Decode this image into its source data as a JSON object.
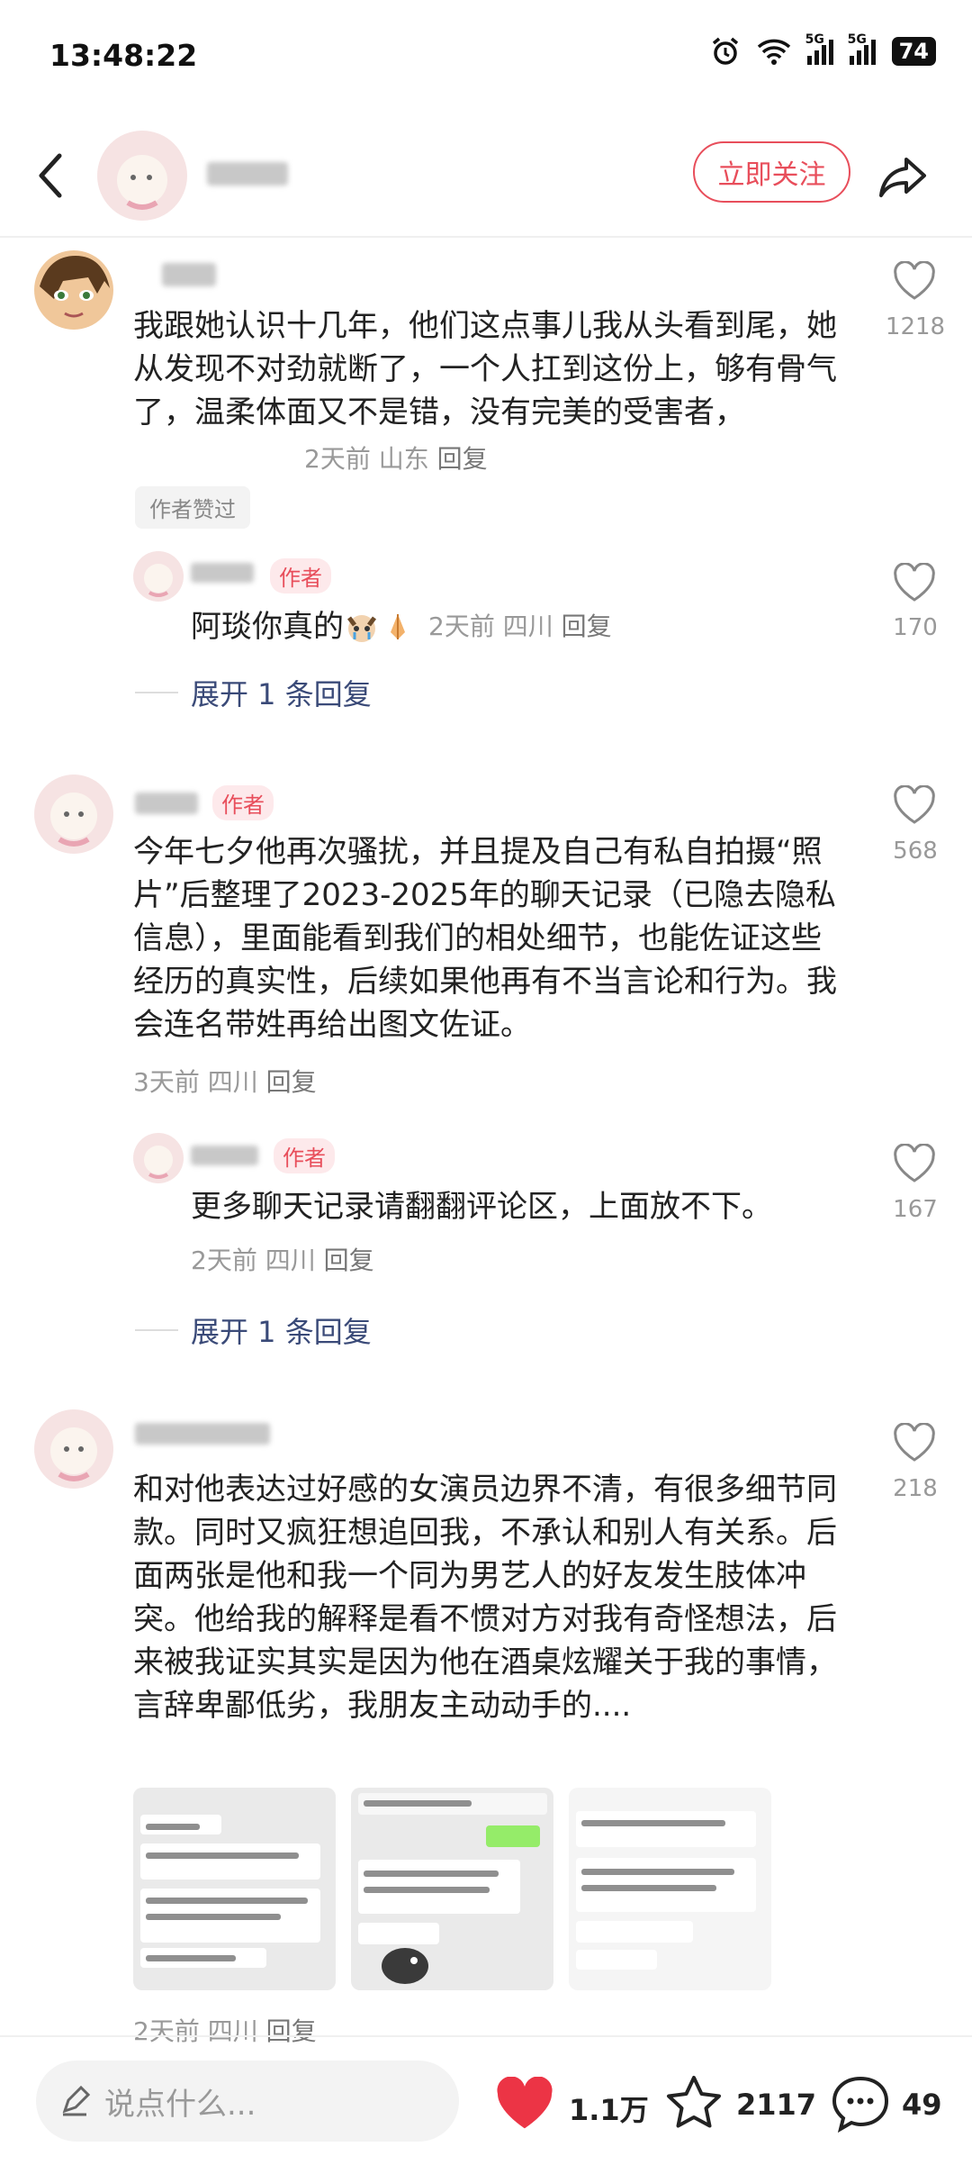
{
  "status": {
    "time": "13:48:22",
    "net1": "5G",
    "net2": "5G",
    "battery": "74"
  },
  "header": {
    "follow_label": "立即关注"
  },
  "comments": [
    {
      "text": "我跟她认识十几年，他们这点事儿我从头看到尾，她从发现不对劲就断了，一个人扛到这份上，够有骨气了，温柔体面又不是错，没有完美的受害者，",
      "time": "2天前",
      "location": "山东",
      "reply_label": "回复",
      "likes": "1218",
      "badge": "作者赞过",
      "sub": {
        "tag": "作者",
        "text": "阿琰你真的",
        "time": "2天前",
        "location": "四川",
        "reply_label": "回复",
        "likes": "170"
      },
      "expand_label": "展开 1 条回复"
    },
    {
      "tag": "作者",
      "text": "今年七夕他再次骚扰，并且提及自己有私自拍摄“照片”后整理了2023-2025年的聊天记录（已隐去隐私信息），里面能看到我们的相处细节，也能佐证这些经历的真实性，后续如果他再有不当言论和行为。我会连名带姓再给出图文佐证。",
      "time": "3天前",
      "location": "四川",
      "reply_label": "回复",
      "likes": "568",
      "sub": {
        "tag": "作者",
        "text": "更多聊天记录请翻翻评论区，上面放不下。",
        "time": "2天前",
        "location": "四川",
        "reply_label": "回复",
        "likes": "167"
      },
      "expand_label": "展开 1 条回复"
    },
    {
      "text": "和对他表达过好感的女演员边界不清，有很多细节同款。同时又疯狂想追回我，不承认和别人有关系。后面两张是他和我一个同为男艺人的好友发生肢体冲突。他给我的解释是看不惯对方对我有奇怪想法，后来被我证实其实是因为他在酒桌炫耀关于我的事情，言辞卑鄙低劣，我朋友主动动手的....",
      "time": "2天前",
      "location": "四川",
      "reply_label": "回复",
      "likes": "218"
    }
  ],
  "bottom": {
    "placeholder": "说点什么...",
    "likes": "1.1万",
    "stars": "2117",
    "comments": "49"
  },
  "colors": {
    "accent": "#e84e5b",
    "link": "#3a4a78",
    "muted": "#999999"
  }
}
